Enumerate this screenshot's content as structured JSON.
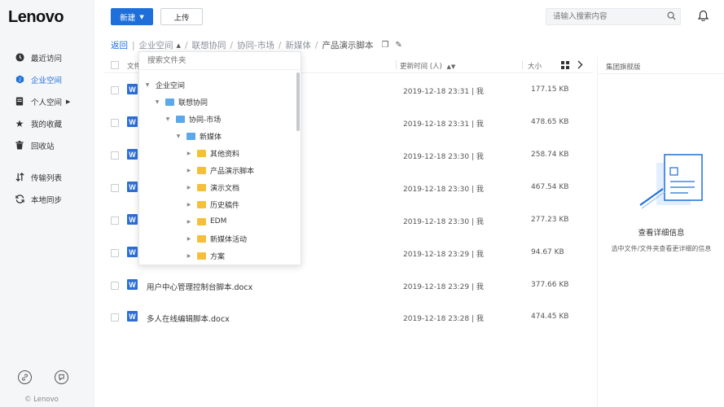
{
  "brand": {
    "logo": "Lenovo",
    "copyright": "© Lenovo"
  },
  "sidebar": {
    "items": [
      {
        "label": "最近访问",
        "icon": "clock-icon"
      },
      {
        "label": "企业空间",
        "icon": "enterprise-icon",
        "active": true
      },
      {
        "label": "个人空间",
        "icon": "personal-icon",
        "has_arrow": true
      },
      {
        "label": "我的收藏",
        "icon": "star-icon"
      },
      {
        "label": "回收站",
        "icon": "trash-icon"
      }
    ],
    "items2": [
      {
        "label": "传输列表",
        "icon": "transfer-icon"
      },
      {
        "label": "本地同步",
        "icon": "sync-icon"
      }
    ]
  },
  "toolbar": {
    "new_label": "新建",
    "upload_label": "上传"
  },
  "search": {
    "placeholder": "请输入搜索内容"
  },
  "breadcrumb": {
    "back": "返回",
    "items": [
      "企业空间",
      "联想协同",
      "协同-市场",
      "新媒体",
      "产品演示脚本"
    ]
  },
  "table": {
    "col_name": "文件",
    "col_time": "更新时间 (人)",
    "col_size": "大小",
    "rows": [
      {
        "name": "",
        "time": "2019-12-18 23:31 | 我",
        "size": "177.15 KB"
      },
      {
        "name": "",
        "time": "2019-12-18 23:31 | 我",
        "size": "478.65 KB"
      },
      {
        "name": "",
        "time": "2019-12-18 23:30 | 我",
        "size": "258.74 KB"
      },
      {
        "name": "",
        "time": "2019-12-18 23:30 | 我",
        "size": "467.54 KB"
      },
      {
        "name": "",
        "time": "2019-12-18 23:30 | 我",
        "size": "277.23 KB"
      },
      {
        "name": "",
        "time": "2019-12-18 23:29 | 我",
        "size": "94.67 KB"
      },
      {
        "name": "用户中心管理控制台脚本.docx",
        "time": "2019-12-18 23:29 | 我",
        "size": "377.66 KB"
      },
      {
        "name": "多人在线编辑脚本.docx",
        "time": "2019-12-18 23:28 | 我",
        "size": "474.45 KB"
      }
    ]
  },
  "right_panel": {
    "title": "集团旗舰版",
    "info_title": "查看详细信息",
    "info_sub": "选中文件/文件夹查看更详细的信息"
  },
  "folder_dropdown": {
    "search_placeholder": "搜索文件夹",
    "tree": [
      {
        "label": "企业空间",
        "depth": 0,
        "expanded": true,
        "folder": "none"
      },
      {
        "label": "联想协同",
        "depth": 1,
        "expanded": true,
        "folder": "blue"
      },
      {
        "label": "协同-市场",
        "depth": 2,
        "expanded": true,
        "folder": "blue"
      },
      {
        "label": "新媒体",
        "depth": 3,
        "expanded": true,
        "folder": "blue"
      },
      {
        "label": "其他资料",
        "depth": 4,
        "expanded": false,
        "folder": "yellow"
      },
      {
        "label": "产品演示脚本",
        "depth": 4,
        "expanded": false,
        "folder": "yellow"
      },
      {
        "label": "演示文档",
        "depth": 4,
        "expanded": false,
        "folder": "yellow"
      },
      {
        "label": "历史稿件",
        "depth": 4,
        "expanded": false,
        "folder": "yellow"
      },
      {
        "label": "EDM",
        "depth": 4,
        "expanded": false,
        "folder": "yellow"
      },
      {
        "label": "新媒体活动",
        "depth": 4,
        "expanded": false,
        "folder": "yellow"
      },
      {
        "label": "方案",
        "depth": 4,
        "expanded": false,
        "folder": "yellow"
      }
    ]
  },
  "colors": {
    "accent": "#1e6fd9",
    "word": "#2b6fd6",
    "folder_blue": "#5ba8ea",
    "folder_yellow": "#f5bf3a"
  }
}
